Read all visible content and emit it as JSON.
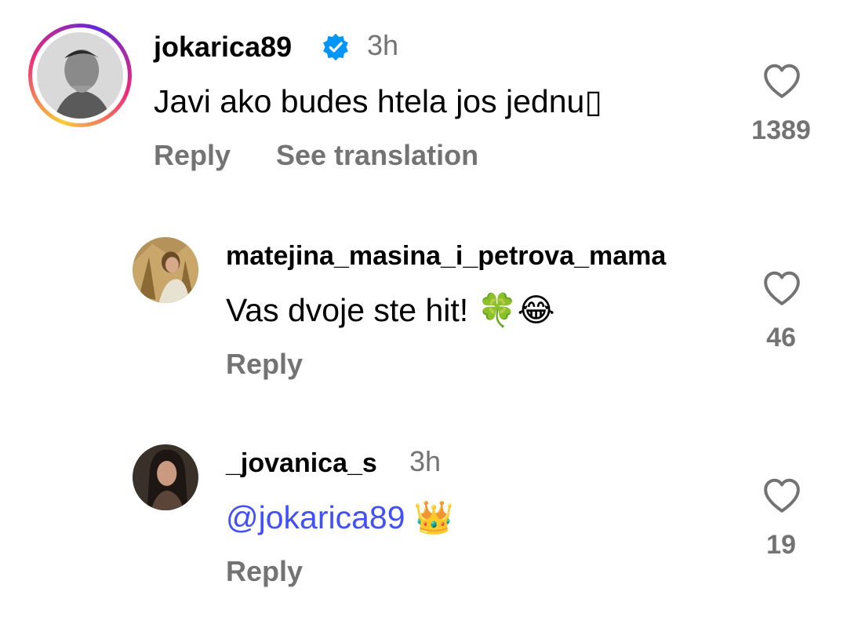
{
  "comments": [
    {
      "username": "jokarica89",
      "verified": true,
      "time": "3h",
      "text": "Javi ako budes htela jos jednu▯",
      "actions": {
        "reply": "Reply",
        "translate": "See translation"
      },
      "likes": "1389",
      "has_story_ring": true
    },
    {
      "username": "matejina_masina_i_petrova_mama",
      "text": "Vas dvoje ste hit! 🍀😂",
      "actions": {
        "reply": "Reply"
      },
      "likes": "46"
    },
    {
      "username": "_jovanica_s",
      "time": "3h",
      "mention": "@jokarica89",
      "text_suffix": " 👑",
      "actions": {
        "reply": "Reply"
      },
      "likes": "19"
    }
  ],
  "colors": {
    "text_primary": "#000000",
    "text_secondary": "#737373",
    "mention": "#4150f7",
    "verified_badge": "#0095f6"
  },
  "icons": [
    "heart-icon",
    "verified-badge-icon",
    "story-ring"
  ]
}
